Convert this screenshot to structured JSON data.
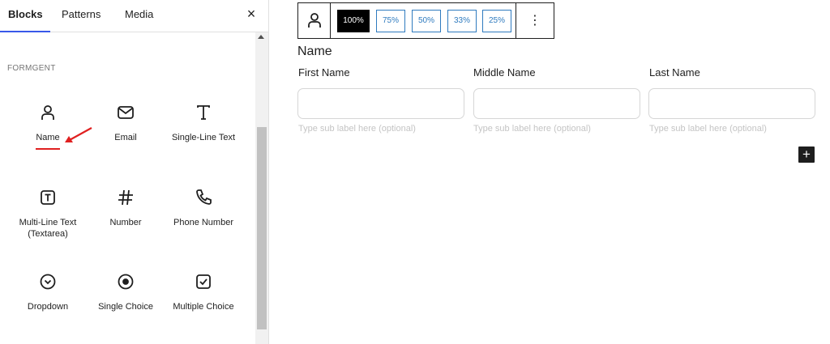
{
  "tabs": [
    {
      "label": "Blocks",
      "active": true
    },
    {
      "label": "Patterns",
      "active": false
    },
    {
      "label": "Media",
      "active": false
    }
  ],
  "close_label": "×",
  "category": "FORMGENT",
  "blocks": [
    {
      "label": "Name",
      "icon": "person-icon"
    },
    {
      "label": "Email",
      "icon": "envelope-icon"
    },
    {
      "label": "Single-Line Text",
      "icon": "text-t-icon"
    },
    {
      "label": "Multi-Line Text (Textarea)",
      "icon": "boxed-t-icon"
    },
    {
      "label": "Number",
      "icon": "hash-icon"
    },
    {
      "label": "Phone Number",
      "icon": "phone-icon"
    },
    {
      "label": "Dropdown",
      "icon": "chevron-circle-icon"
    },
    {
      "label": "Single Choice",
      "icon": "radio-icon"
    },
    {
      "label": "Multiple Choice",
      "icon": "checkbox-icon"
    }
  ],
  "toolbar": {
    "widths": [
      "100%",
      "75%",
      "50%",
      "33%",
      "25%"
    ],
    "active_width": "100%",
    "more_label": "⋮"
  },
  "field": {
    "title": "Name",
    "subfields": [
      {
        "label": "First Name",
        "value": "",
        "hint": "Type sub label here (optional)"
      },
      {
        "label": "Middle Name",
        "value": "",
        "hint": "Type sub label here (optional)"
      },
      {
        "label": "Last Name",
        "value": "",
        "hint": "Type sub label here (optional)"
      }
    ]
  },
  "add_label": "+",
  "colors": {
    "accent": "#3858e9",
    "width_button": "#2f7bbf",
    "annotation": "#e02020"
  }
}
